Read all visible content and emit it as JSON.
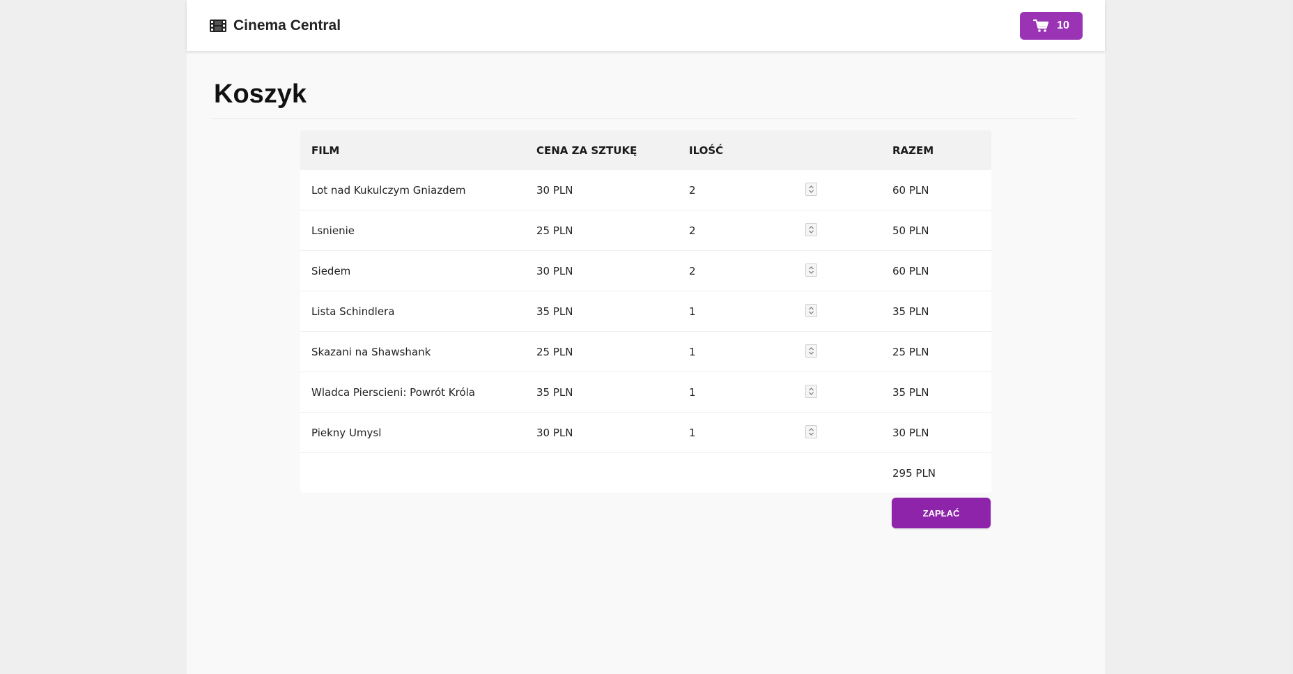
{
  "header": {
    "brand_icon": "film-icon",
    "brand_name": "Cinema Central",
    "cart_icon": "shopping-cart-icon",
    "cart_count": "10",
    "accent_color": "#9a34b5"
  },
  "page": {
    "title": "Koszyk"
  },
  "table": {
    "headers": {
      "film": "FILM",
      "price": "CENA ZA SZTUKĘ",
      "qty": "ILOŚĆ",
      "total": "RAZEM"
    },
    "rows": [
      {
        "film": "Lot nad Kukulczym Gniazdem",
        "price": "30 PLN",
        "qty": "2",
        "total": "60 PLN"
      },
      {
        "film": "Lsnienie",
        "price": "25 PLN",
        "qty": "2",
        "total": "50 PLN"
      },
      {
        "film": "Siedem",
        "price": "30 PLN",
        "qty": "2",
        "total": "60 PLN"
      },
      {
        "film": "Lista Schindlera",
        "price": "35 PLN",
        "qty": "1",
        "total": "35 PLN"
      },
      {
        "film": "Skazani na Shawshank",
        "price": "25 PLN",
        "qty": "1",
        "total": "25 PLN"
      },
      {
        "film": "Wladca Pierscieni: Powrót Króla",
        "price": "35 PLN",
        "qty": "1",
        "total": "35 PLN"
      },
      {
        "film": "Piekny Umysl",
        "price": "30 PLN",
        "qty": "1",
        "total": "30 PLN"
      }
    ],
    "grand_total": "295 PLN"
  },
  "actions": {
    "pay_label": "ZAPŁAĆ",
    "pay_color": "#8e24aa"
  }
}
